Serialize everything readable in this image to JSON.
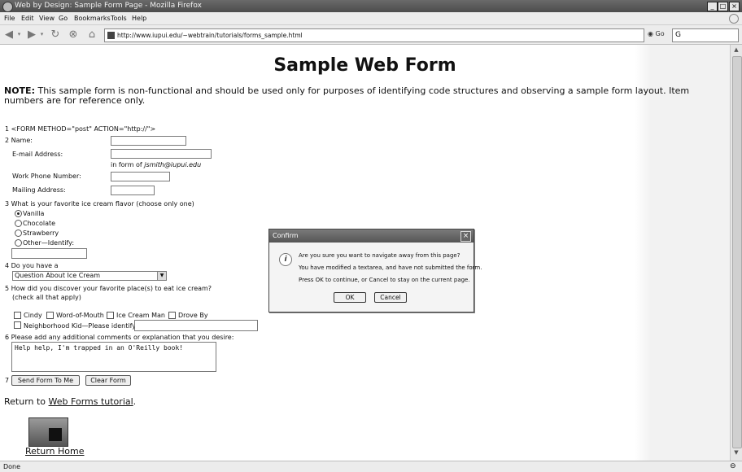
{
  "window": {
    "title": "Web by Design: Sample Form Page - Mozilla Firefox"
  },
  "menu": [
    "File",
    "Edit",
    "View",
    "Go",
    "Bookmarks",
    "Tools",
    "Help"
  ],
  "nav": {
    "url": "http://www.iupui.edu/~webtrain/tutorials/forms_sample.html",
    "go_label": "Go",
    "search_value": "G"
  },
  "page": {
    "title": "Sample Web Form",
    "note_label": "NOTE:",
    "note_text": " This sample form is non-functional and should be used only for purposes of identifying code structures and observing a sample form layout. Item numbers are for reference only.",
    "form_tag": "1 <FORM METHOD=\"post\" ACTION=\"http://\">",
    "name_label": "2 Name:",
    "email_label": "E-mail Address:",
    "email_hint_prefix": "in form of ",
    "email_hint_example": "jsmith@iupui.edu",
    "phone_label": "Work Phone Number:",
    "mailing_label": "Mailing Address:",
    "flavor_question": "3 What is your favorite ice cream flavor (choose only one)",
    "flavors": [
      "Vanilla",
      "Chocolate",
      "Strawberry",
      "Other—Identify:"
    ],
    "have_label": "4 Do you have a",
    "select_value": "Question About Ice Cream",
    "discover_question": "5 How did you discover your favorite place(s) to eat ice cream?",
    "discover_hint": "(check all that apply)",
    "checks": [
      "Cindy",
      "Word-of-Mouth",
      "Ice Cream Man",
      "Drove By"
    ],
    "neighborhood_label": "Neighborhood Kid—Please identify:",
    "comments_label": "6 Please add any additional comments or explanation that you desire:",
    "comments_value": "Help help, I'm trapped in an O'Reilly book!",
    "item7": "7",
    "send_label": "Send Form To Me",
    "clear_label": "Clear Form",
    "return_prefix": "Return to ",
    "return_link": "Web Forms tutorial",
    "return_suffix": ".",
    "home_link": "Return Home"
  },
  "dialog": {
    "title": "Confirm",
    "line1": "Are you sure you want to navigate away from this page?",
    "line2": "You have modified a textarea, and have not submitted the form.",
    "line3": "Press OK to continue, or Cancel to stay on the current page.",
    "ok": "OK",
    "cancel": "Cancel"
  },
  "status": {
    "text": "Done"
  }
}
